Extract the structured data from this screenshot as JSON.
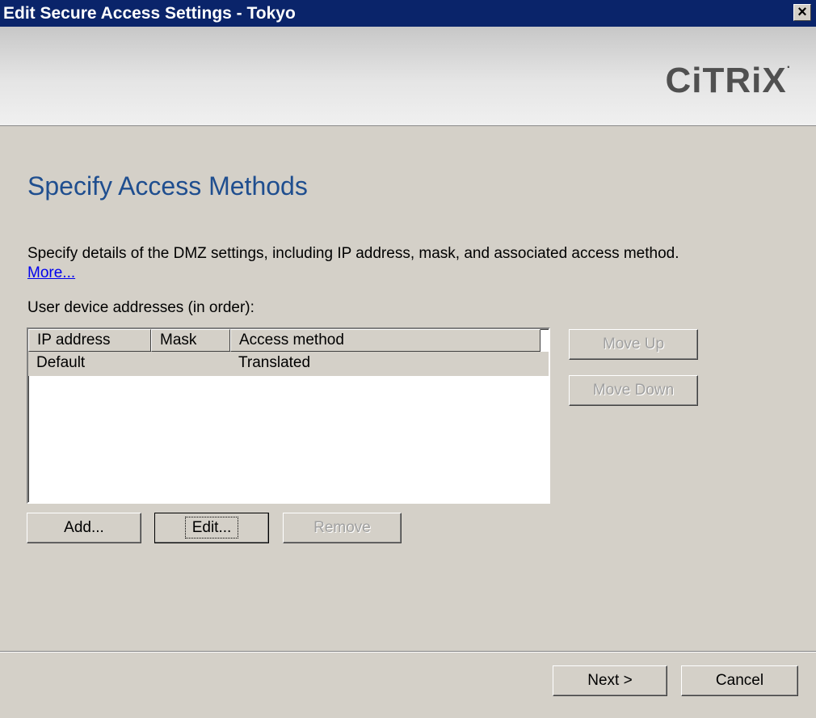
{
  "window": {
    "title": "Edit Secure Access Settings - Tokyo",
    "close_label": "✕"
  },
  "banner": {
    "logo_text": "CiTRiX"
  },
  "page": {
    "heading": "Specify Access Methods",
    "description": "Specify details of the DMZ settings, including IP address, mask, and associated access method.",
    "more_link": "More...",
    "list_label": "User device addresses (in order):"
  },
  "list": {
    "columns": [
      "IP address",
      "Mask",
      "Access method"
    ],
    "rows": [
      {
        "ip": "Default",
        "mask": "",
        "method": "Translated",
        "selected": true
      }
    ]
  },
  "buttons": {
    "move_up": "Move Up",
    "move_down": "Move Down",
    "add": "Add...",
    "edit": "Edit...",
    "remove": "Remove",
    "next": "Next >",
    "cancel": "Cancel"
  }
}
